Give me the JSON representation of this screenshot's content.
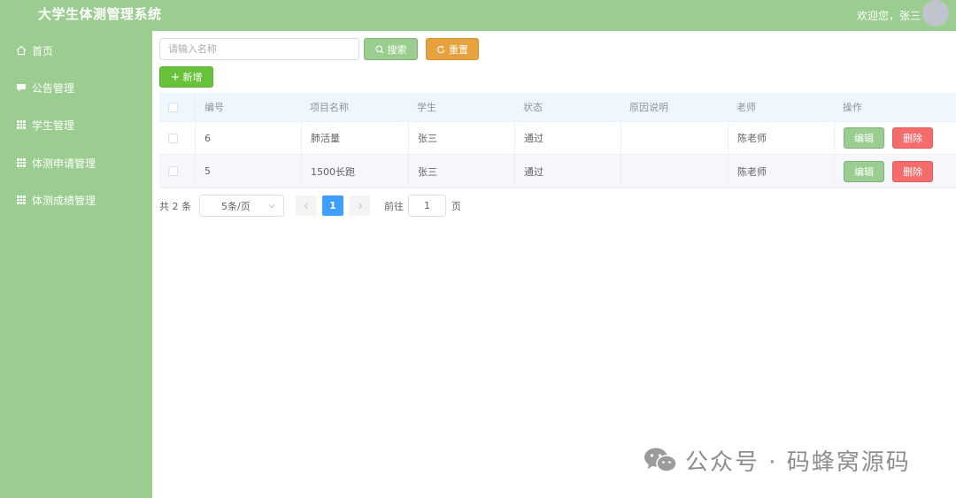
{
  "header": {
    "app_title": "大学生体测管理系统",
    "welcome": "欢迎您，张三"
  },
  "sidebar": {
    "items": [
      {
        "label": "首页",
        "icon": "home-icon"
      },
      {
        "label": "公告管理",
        "icon": "notice-icon"
      },
      {
        "label": "学生管理",
        "icon": "grid-icon"
      },
      {
        "label": "体测申请管理",
        "icon": "grid-icon"
      },
      {
        "label": "体测成绩管理",
        "icon": "grid-icon"
      }
    ]
  },
  "toolbar": {
    "search_placeholder": "请输入名称",
    "search_label": "搜索",
    "reset_label": "重置",
    "add_label": "新增"
  },
  "table": {
    "columns": [
      "编号",
      "项目名称",
      "学生",
      "状态",
      "原因说明",
      "老师",
      "操作"
    ],
    "rows": [
      {
        "id": "6",
        "project": "肺活量",
        "student": "张三",
        "status": "通过",
        "reason": "",
        "teacher": "陈老师"
      },
      {
        "id": "5",
        "project": "1500长跑",
        "student": "张三",
        "status": "通过",
        "reason": "",
        "teacher": "陈老师"
      }
    ],
    "edit_label": "编辑",
    "delete_label": "删除"
  },
  "pagination": {
    "total_text": "共 2 条",
    "page_size": "5条/页",
    "current_page": "1",
    "goto_label": "前往",
    "goto_value": "1",
    "page_suffix": "页"
  },
  "watermark": {
    "text": "公众号 · 码蜂窝源码"
  },
  "colors": {
    "theme_green": "#9acd8f",
    "primary_blue": "#409eff",
    "warning_orange": "#e6a23c",
    "success_green": "#67c23a",
    "danger_red": "#f56c6c"
  }
}
